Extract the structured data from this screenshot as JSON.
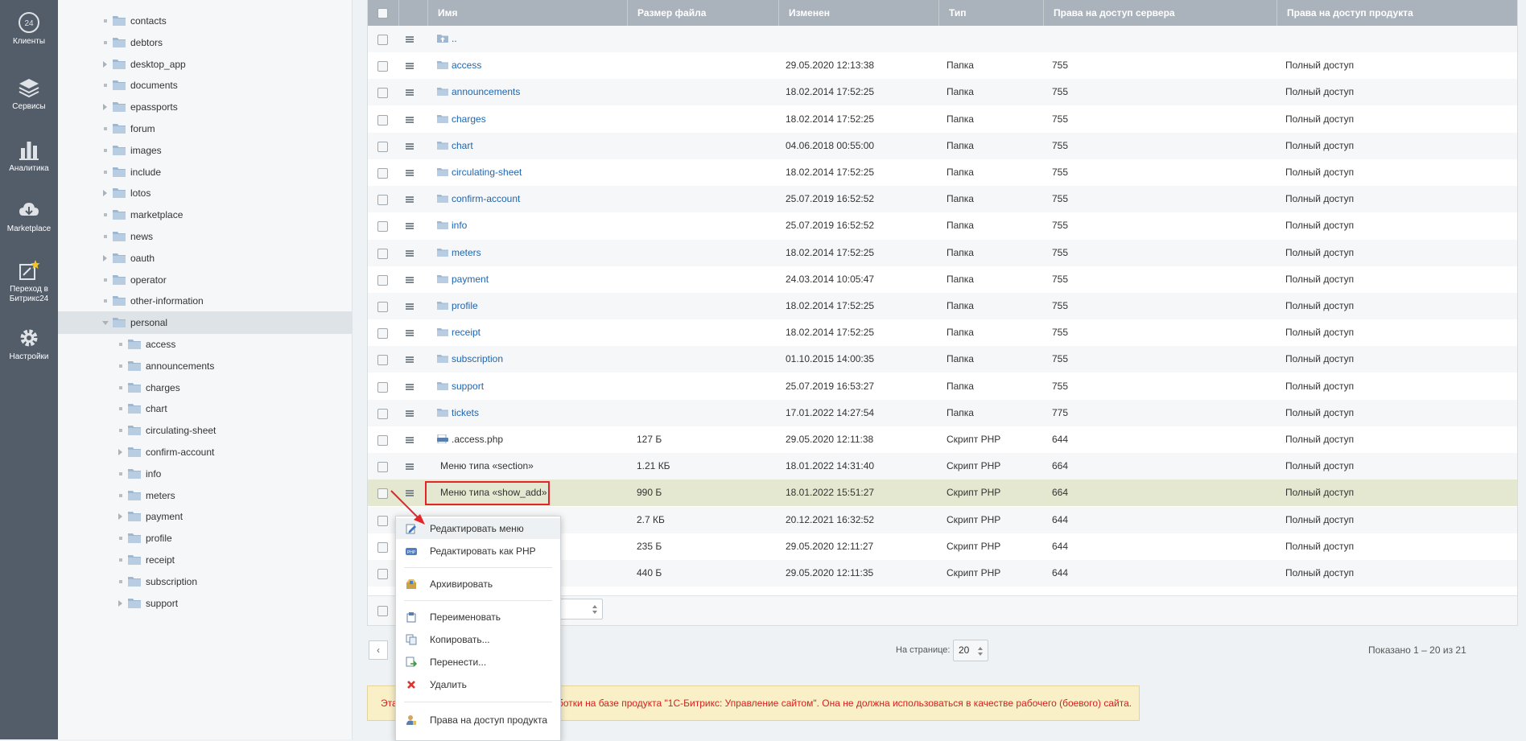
{
  "appbar": {
    "items": [
      {
        "label": "Клиенты",
        "icon": "clients-24-icon"
      },
      {
        "label": "Сервисы",
        "icon": "layers-icon"
      },
      {
        "label": "Аналитика",
        "icon": "bar-chart-icon"
      },
      {
        "label": "Marketplace",
        "icon": "cloud-download-icon"
      },
      {
        "label": "Переход в Битрикс24",
        "icon": "external-star-icon"
      },
      {
        "label": "Настройки",
        "icon": "gear-icon"
      }
    ]
  },
  "tree": {
    "items": [
      {
        "label": "contacts",
        "marker": "dot",
        "level": 0
      },
      {
        "label": "debtors",
        "marker": "dot",
        "level": 0
      },
      {
        "label": "desktop_app",
        "marker": "arrow",
        "level": 0
      },
      {
        "label": "documents",
        "marker": "dot",
        "level": 0
      },
      {
        "label": "epassports",
        "marker": "arrow",
        "level": 0
      },
      {
        "label": "forum",
        "marker": "dot",
        "level": 0
      },
      {
        "label": "images",
        "marker": "dot",
        "level": 0
      },
      {
        "label": "include",
        "marker": "dot",
        "level": 0
      },
      {
        "label": "lotos",
        "marker": "arrow",
        "level": 0
      },
      {
        "label": "marketplace",
        "marker": "dot",
        "level": 0
      },
      {
        "label": "news",
        "marker": "dot",
        "level": 0
      },
      {
        "label": "oauth",
        "marker": "arrow",
        "level": 0
      },
      {
        "label": "operator",
        "marker": "dot",
        "level": 0
      },
      {
        "label": "other-information",
        "marker": "dot",
        "level": 0
      },
      {
        "label": "personal",
        "marker": "open",
        "level": 0,
        "active": true
      },
      {
        "label": "access",
        "marker": "dot",
        "level": 1
      },
      {
        "label": "announcements",
        "marker": "dot",
        "level": 1
      },
      {
        "label": "charges",
        "marker": "dot",
        "level": 1
      },
      {
        "label": "chart",
        "marker": "dot",
        "level": 1
      },
      {
        "label": "circulating-sheet",
        "marker": "dot",
        "level": 1
      },
      {
        "label": "confirm-account",
        "marker": "arrow",
        "level": 1
      },
      {
        "label": "info",
        "marker": "dot",
        "level": 1
      },
      {
        "label": "meters",
        "marker": "dot",
        "level": 1
      },
      {
        "label": "payment",
        "marker": "arrow",
        "level": 1
      },
      {
        "label": "profile",
        "marker": "dot",
        "level": 1
      },
      {
        "label": "receipt",
        "marker": "dot",
        "level": 1
      },
      {
        "label": "subscription",
        "marker": "dot",
        "level": 1
      },
      {
        "label": "support",
        "marker": "arrow",
        "level": 1
      }
    ]
  },
  "table": {
    "headers": [
      "Имя",
      "Размер файла",
      "Изменен",
      "Тип",
      "Права на доступ сервера",
      "Права на доступ продукта"
    ],
    "rows": [
      {
        "name": "..",
        "icon": "up",
        "size": "",
        "modified": "",
        "type": "",
        "server": "",
        "product": ""
      },
      {
        "name": "access",
        "icon": "folder",
        "size": "",
        "modified": "29.05.2020 12:13:38",
        "type": "Папка",
        "server": "755",
        "product": "Полный доступ"
      },
      {
        "name": "announcements",
        "icon": "folder",
        "size": "",
        "modified": "18.02.2014 17:52:25",
        "type": "Папка",
        "server": "755",
        "product": "Полный доступ"
      },
      {
        "name": "charges",
        "icon": "folder",
        "size": "",
        "modified": "18.02.2014 17:52:25",
        "type": "Папка",
        "server": "755",
        "product": "Полный доступ"
      },
      {
        "name": "chart",
        "icon": "folder",
        "size": "",
        "modified": "04.06.2018 00:55:00",
        "type": "Папка",
        "server": "755",
        "product": "Полный доступ"
      },
      {
        "name": "circulating-sheet",
        "icon": "folder",
        "size": "",
        "modified": "18.02.2014 17:52:25",
        "type": "Папка",
        "server": "755",
        "product": "Полный доступ"
      },
      {
        "name": "confirm-account",
        "icon": "folder",
        "size": "",
        "modified": "25.07.2019 16:52:52",
        "type": "Папка",
        "server": "755",
        "product": "Полный доступ"
      },
      {
        "name": "info",
        "icon": "folder",
        "size": "",
        "modified": "25.07.2019 16:52:52",
        "type": "Папка",
        "server": "755",
        "product": "Полный доступ"
      },
      {
        "name": "meters",
        "icon": "folder",
        "size": "",
        "modified": "18.02.2014 17:52:25",
        "type": "Папка",
        "server": "755",
        "product": "Полный доступ"
      },
      {
        "name": "payment",
        "icon": "folder",
        "size": "",
        "modified": "24.03.2014 10:05:47",
        "type": "Папка",
        "server": "755",
        "product": "Полный доступ"
      },
      {
        "name": "profile",
        "icon": "folder",
        "size": "",
        "modified": "18.02.2014 17:52:25",
        "type": "Папка",
        "server": "755",
        "product": "Полный доступ"
      },
      {
        "name": "receipt",
        "icon": "folder",
        "size": "",
        "modified": "18.02.2014 17:52:25",
        "type": "Папка",
        "server": "755",
        "product": "Полный доступ"
      },
      {
        "name": "subscription",
        "icon": "folder",
        "size": "",
        "modified": "01.10.2015 14:00:35",
        "type": "Папка",
        "server": "755",
        "product": "Полный доступ"
      },
      {
        "name": "support",
        "icon": "folder",
        "size": "",
        "modified": "25.07.2019 16:53:27",
        "type": "Папка",
        "server": "755",
        "product": "Полный доступ"
      },
      {
        "name": "tickets",
        "icon": "folder",
        "size": "",
        "modified": "17.01.2022 14:27:54",
        "type": "Папка",
        "server": "775",
        "product": "Полный доступ"
      },
      {
        "name": ".access.php",
        "icon": "php",
        "size": "127 Б",
        "modified": "29.05.2020 12:11:38",
        "type": "Скрипт PHP",
        "server": "644",
        "product": "Полный доступ"
      },
      {
        "name": "Меню типа «section»",
        "icon": "none",
        "size": "1.21 КБ",
        "modified": "18.01.2022 14:31:40",
        "type": "Скрипт PHP",
        "server": "664",
        "product": "Полный доступ"
      },
      {
        "name": "Меню типа «show_add»",
        "icon": "none",
        "size": "990 Б",
        "modified": "18.01.2022 15:51:27",
        "type": "Скрипт PHP",
        "server": "664",
        "product": "Полный доступ",
        "highlight": true
      },
      {
        "name": "",
        "icon": "none",
        "size": "2.7 КБ",
        "modified": "20.12.2021 16:32:52",
        "type": "Скрипт PHP",
        "server": "644",
        "product": "Полный доступ"
      },
      {
        "name": "",
        "icon": "none",
        "size": "235 Б",
        "modified": "29.05.2020 12:11:27",
        "type": "Скрипт PHP",
        "server": "644",
        "product": "Полный доступ"
      },
      {
        "name": "",
        "icon": "none",
        "size": "440 Б",
        "modified": "29.05.2020 12:11:35",
        "type": "Скрипт PHP",
        "server": "644",
        "product": "Полный доступ"
      }
    ]
  },
  "pager": {
    "prev": "‹",
    "per_page_label": "На странице:",
    "per_page_value": "20",
    "shown": "Показано 1 – 20 из 21"
  },
  "warning": {
    "start": "Эта",
    "end": "ботки на базе продукта \"1С-Битрикс: Управление сайтом\". Она не должна использоваться в качестве рабочего (боевого) сайта."
  },
  "context_menu": {
    "items": [
      {
        "label": "Редактировать меню",
        "icon": "edit-menu-icon"
      },
      {
        "label": "Редактировать как PHP",
        "icon": "php-icon"
      },
      {
        "label": "Архивировать",
        "icon": "archive-icon"
      },
      {
        "label": "Переименовать",
        "icon": "rename-icon"
      },
      {
        "label": "Копировать...",
        "icon": "copy-icon"
      },
      {
        "label": "Перенести...",
        "icon": "move-icon"
      },
      {
        "label": "Удалить",
        "icon": "delete-icon"
      },
      {
        "label": "Права на доступ продукта",
        "icon": "user-rights-icon"
      }
    ]
  },
  "colors": {
    "appbar": "#535c69",
    "table_header": "#aab3bc",
    "highlight_row": "#e5e8d0",
    "link": "#2066b0",
    "highlight_border": "#e3242b",
    "warning_text": "#d52020"
  }
}
